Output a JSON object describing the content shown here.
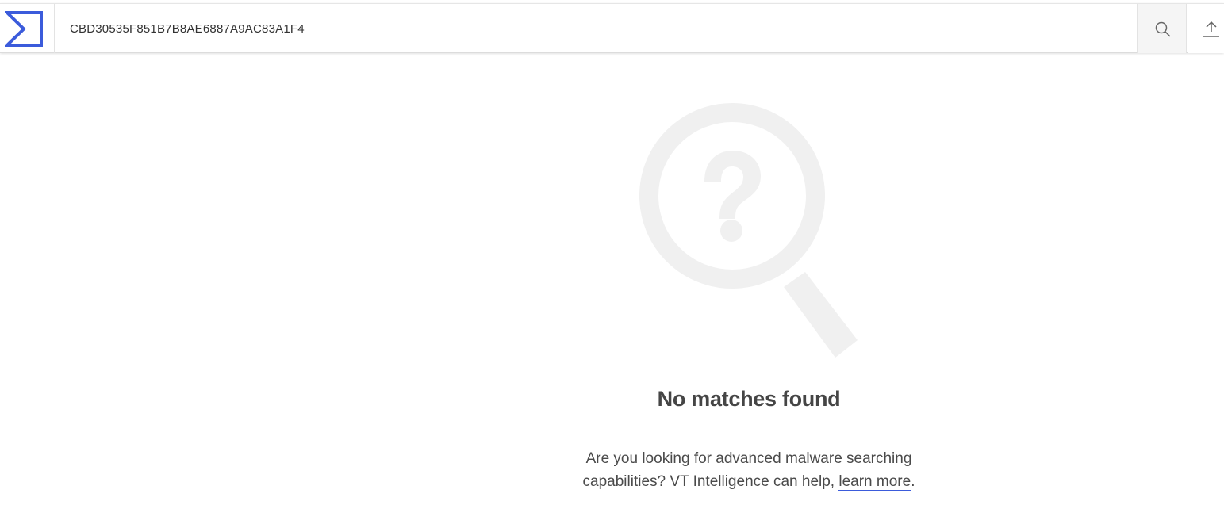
{
  "header": {
    "logo_icon": "virustotal-sigma-logo-icon",
    "search": {
      "value": "CBD30535F851B7B8AE6887A9AC83A1F4",
      "icon": "search-icon"
    },
    "upload": {
      "icon": "upload-icon"
    },
    "brand_color": "#3b5bdb"
  },
  "main": {
    "illustration_icon": "magnifier-question-icon",
    "title": "No matches found",
    "description_prefix": "Are you looking for advanced malware searching capabilities? VT Intelligence can help, ",
    "link_text": "learn more",
    "description_suffix": "."
  }
}
